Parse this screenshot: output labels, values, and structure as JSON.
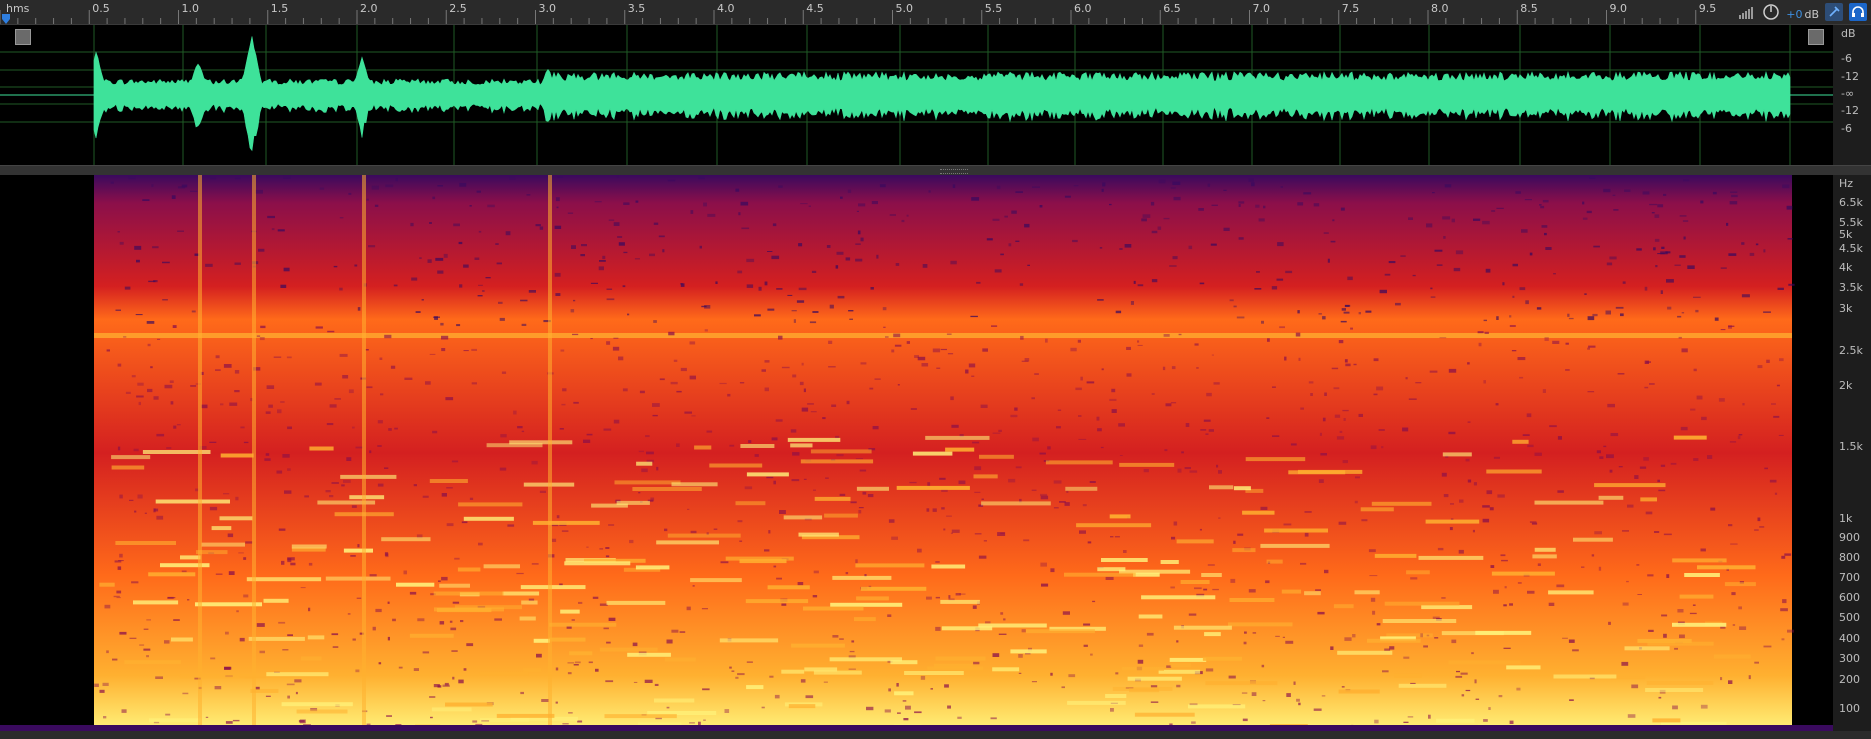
{
  "ruler": {
    "unit_label": "hms",
    "time_labels": [
      "0.5",
      "1.0",
      "1.5",
      "2.0",
      "2.5",
      "3.0",
      "3.5",
      "4.0",
      "4.5",
      "5.0",
      "5.5",
      "6.0",
      "6.5",
      "7.0",
      "7.5",
      "8.0",
      "8.5",
      "9.0",
      "9.5"
    ]
  },
  "controls": {
    "gain_value": "+0",
    "gain_unit": "dB",
    "icons": [
      "level-meter-icon",
      "gain-knob-icon",
      "pin-icon",
      "help-icon"
    ]
  },
  "waveform": {
    "scale_labels": [
      "dB",
      "-6",
      "-12",
      "-∞",
      "-12",
      "-6"
    ],
    "color": "#3ee29a",
    "gridline_color": "#1f5a26"
  },
  "spectrogram": {
    "scale_labels": [
      "Hz",
      "6.5k",
      "5.5k",
      "5k",
      "4.5k",
      "4k",
      "3.5k",
      "3k",
      "2.5k",
      "2k",
      "1.5k",
      "1k",
      "900",
      "800",
      "700",
      "600",
      "500",
      "400",
      "300",
      "200",
      "100"
    ],
    "palette": [
      "#000000",
      "#3a0a5e",
      "#8b0f4a",
      "#d42020",
      "#ff6a1a",
      "#ffb030",
      "#fff27a"
    ]
  }
}
